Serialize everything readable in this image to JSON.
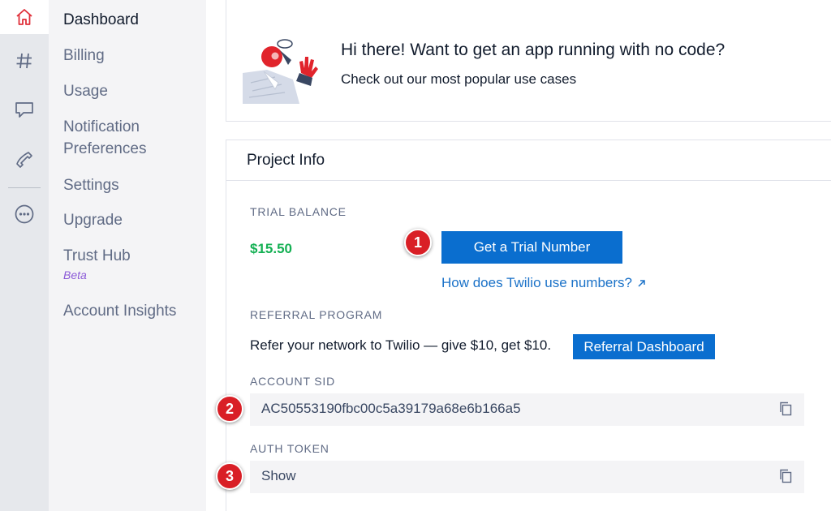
{
  "rail": {
    "icons": [
      "home-icon",
      "hash-icon",
      "chat-icon",
      "phone-icon",
      "more-icon"
    ]
  },
  "sidebar": {
    "items": [
      {
        "label": "Dashboard"
      },
      {
        "label": "Billing"
      },
      {
        "label": "Usage"
      },
      {
        "label": "Notification"
      },
      {
        "label": "Preferences"
      },
      {
        "label": "Settings"
      },
      {
        "label": "Upgrade"
      },
      {
        "label": "Trust Hub"
      },
      {
        "label": "Account Insights"
      }
    ],
    "beta": "Beta"
  },
  "promo": {
    "headline": "Hi there! Want to get an app running with no code?",
    "subtext": "Check out our most popular use cases"
  },
  "project_info": {
    "title": "Project Info",
    "trial_balance_label": "TRIAL BALANCE",
    "trial_balance_value": "$15.50",
    "trial_number_button": "Get a Trial Number",
    "numbers_link": "How does Twilio use numbers?",
    "referral_label": "REFERRAL PROGRAM",
    "referral_text": "Refer your network to Twilio — give $10, get $10.",
    "referral_button": "Referral Dashboard",
    "account_sid_label": "ACCOUNT SID",
    "account_sid_value": "AC50553190fbc00c5a39179a68e6b166a5",
    "auth_token_label": "AUTH TOKEN",
    "auth_token_value": "Show"
  },
  "callouts": [
    "1",
    "2",
    "3"
  ],
  "colors": {
    "accent": "#0a6ecf",
    "balance": "#14b053",
    "callout": "#d91f26",
    "home_icon": "#e0303a"
  }
}
